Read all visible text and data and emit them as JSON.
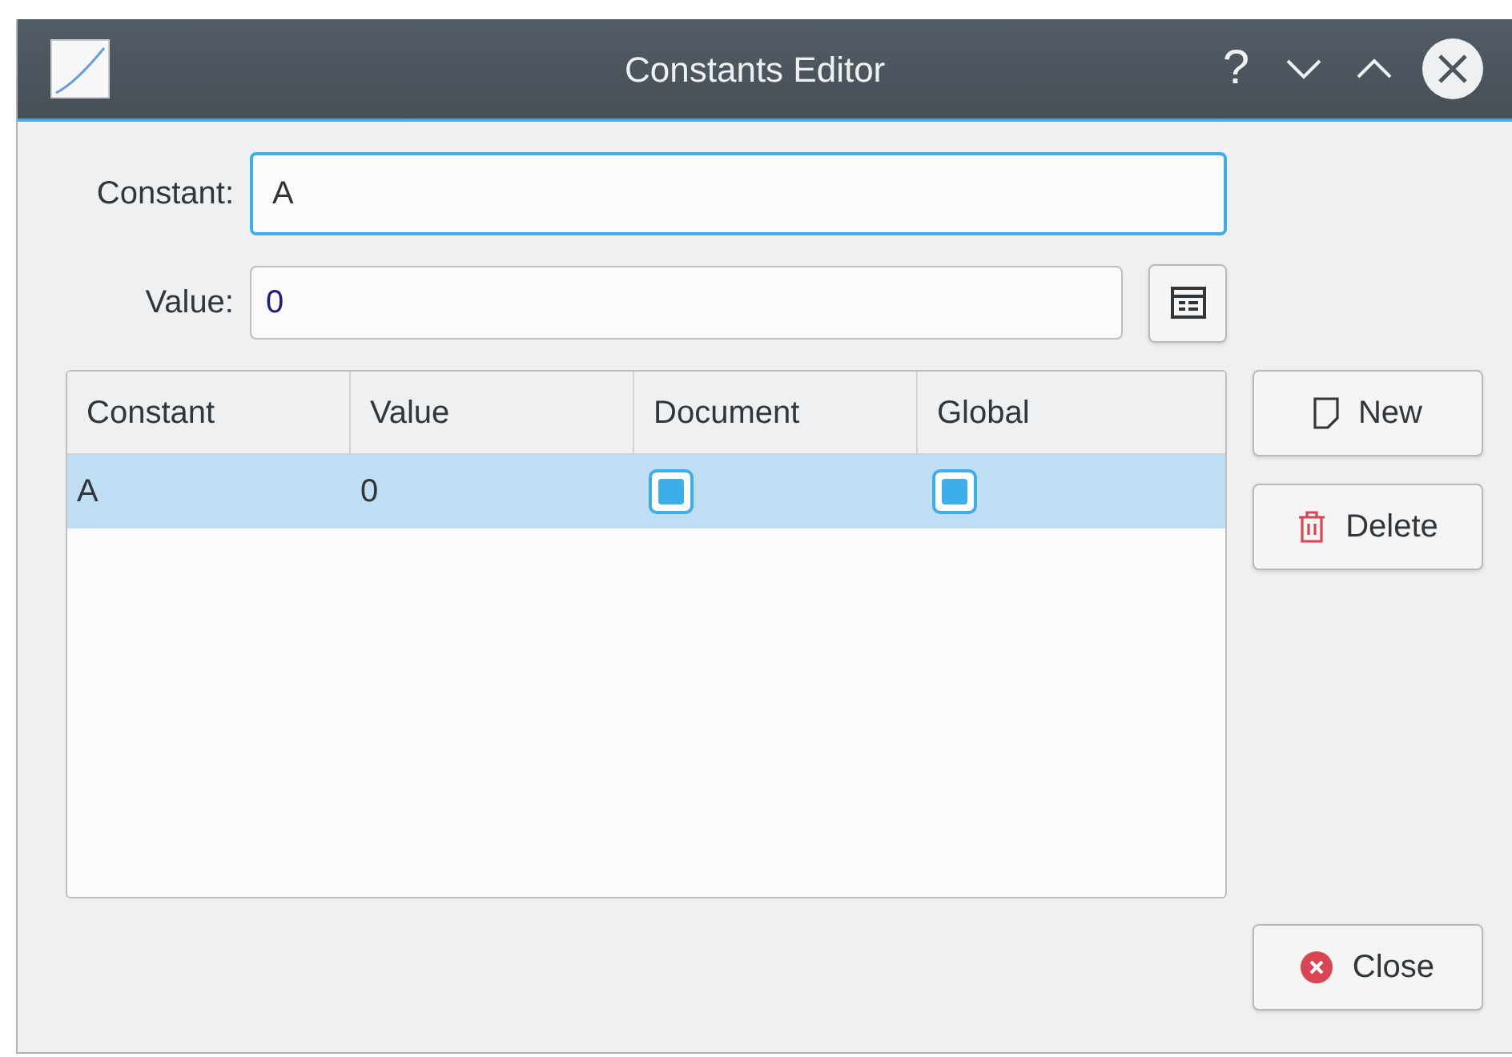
{
  "window": {
    "title": "Constants Editor",
    "controls": [
      "?"
    ]
  },
  "form": {
    "constant_label": "Constant:",
    "constant_value": "A",
    "value_label": "Value:",
    "value_value": "0"
  },
  "table": {
    "columns": [
      "Constant",
      "Value",
      "Document",
      "Global"
    ],
    "rows": [
      {
        "constant": "A",
        "value": "0",
        "document": true,
        "global": true,
        "selected": true
      }
    ]
  },
  "buttons": {
    "new": "New",
    "delete": "Delete",
    "close": "Close"
  }
}
